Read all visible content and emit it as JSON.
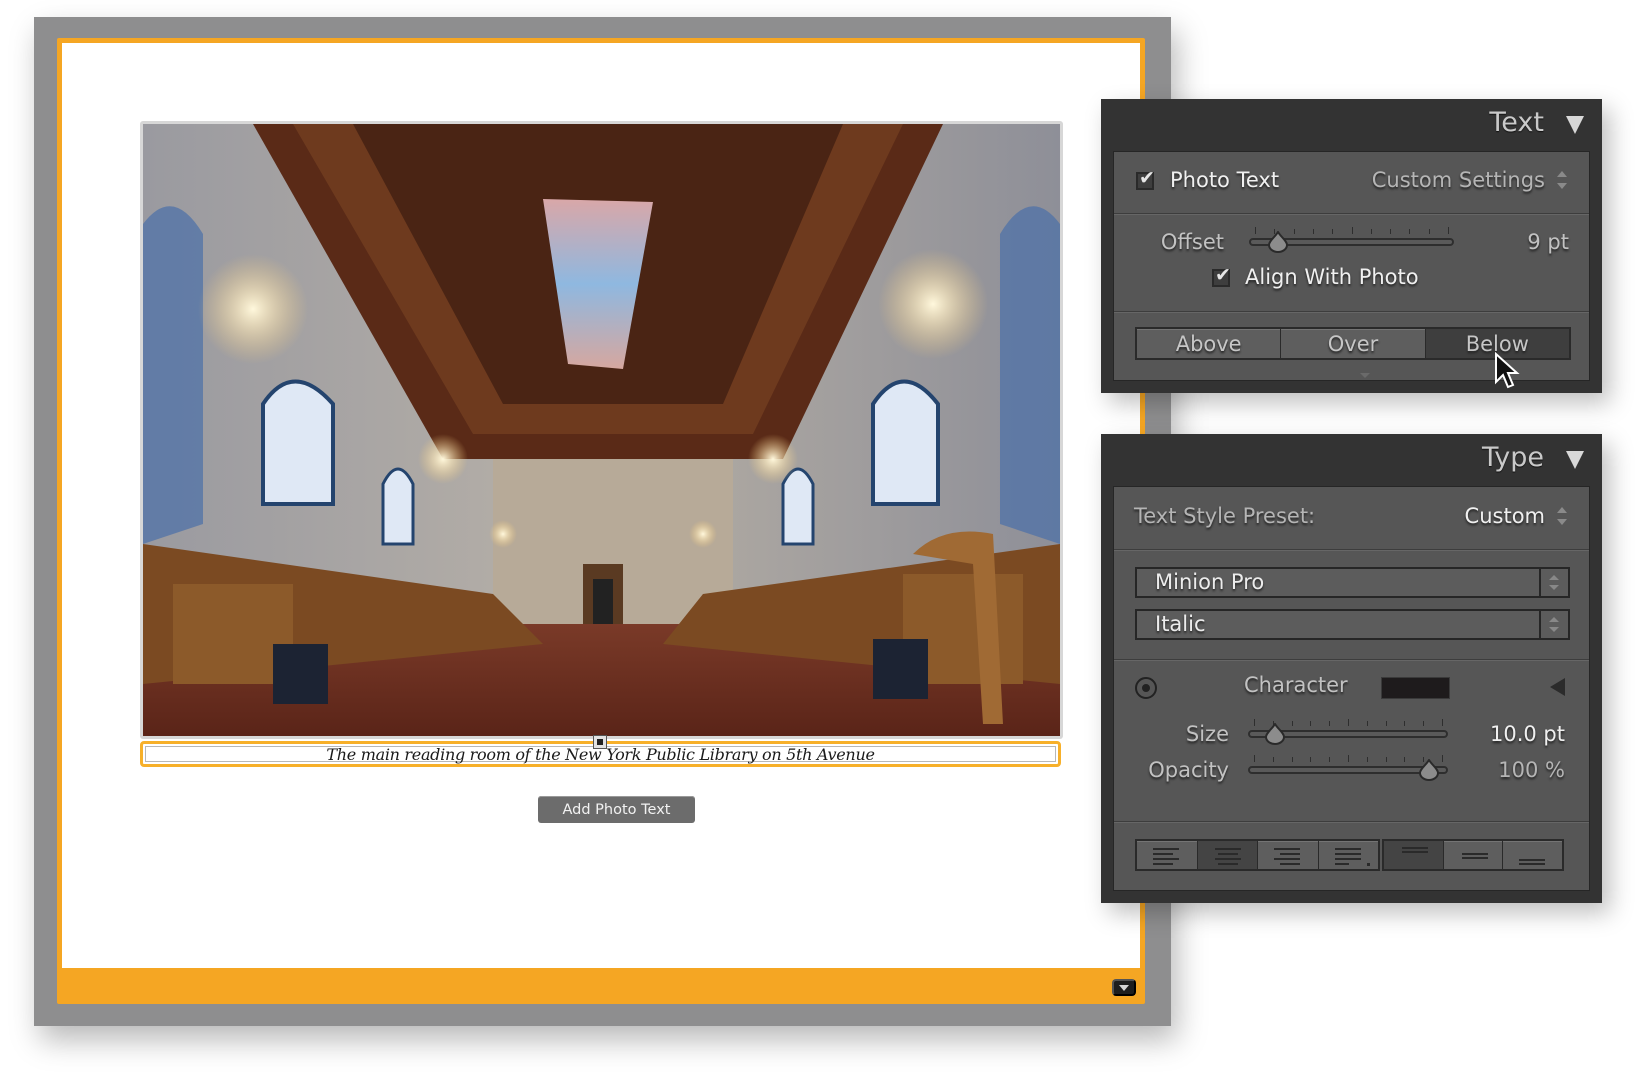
{
  "page": {
    "accent_color": "#f5a623",
    "frame_color": "#8e8e8f",
    "photo_description": "The main reading room of the New York Public Library",
    "caption": "The main reading room of the New York Public Library on 5th Avenue",
    "add_photo_text_button": "Add Photo Text",
    "page_menu_icon": "triangle-down-icon"
  },
  "text_panel": {
    "title": "Text",
    "collapse_icon": "triangle-down-icon",
    "photo_text": {
      "label": "Photo Text",
      "checked": true,
      "preset": "Custom Settings"
    },
    "offset": {
      "label": "Offset",
      "value": "9 pt",
      "slider_fraction": 0.12
    },
    "align_with_photo": {
      "label": "Align With Photo",
      "checked": true
    },
    "position_buttons": [
      {
        "label": "Above",
        "active": false
      },
      {
        "label": "Over",
        "active": false
      },
      {
        "label": "Below",
        "active": true
      }
    ]
  },
  "type_panel": {
    "title": "Type",
    "collapse_icon": "triangle-down-icon",
    "text_style_preset": {
      "label": "Text Style Preset:",
      "value": "Custom"
    },
    "font_family": "Minion Pro",
    "font_style": "Italic",
    "character": {
      "label": "Character",
      "color": "#1e1b1c"
    },
    "size": {
      "label": "Size",
      "value": "10.0 pt",
      "slider_fraction": 0.11
    },
    "opacity": {
      "label": "Opacity",
      "value": "100 %",
      "slider_fraction": 0.93
    },
    "alignment_buttons": [
      {
        "name": "align-left",
        "active": false
      },
      {
        "name": "align-center",
        "active": true
      },
      {
        "name": "align-right",
        "active": false
      },
      {
        "name": "justify",
        "active": false
      }
    ],
    "vertical_alignment_buttons": [
      {
        "name": "align-top",
        "active": true
      },
      {
        "name": "align-middle",
        "active": false
      },
      {
        "name": "align-bottom",
        "active": false
      }
    ]
  }
}
